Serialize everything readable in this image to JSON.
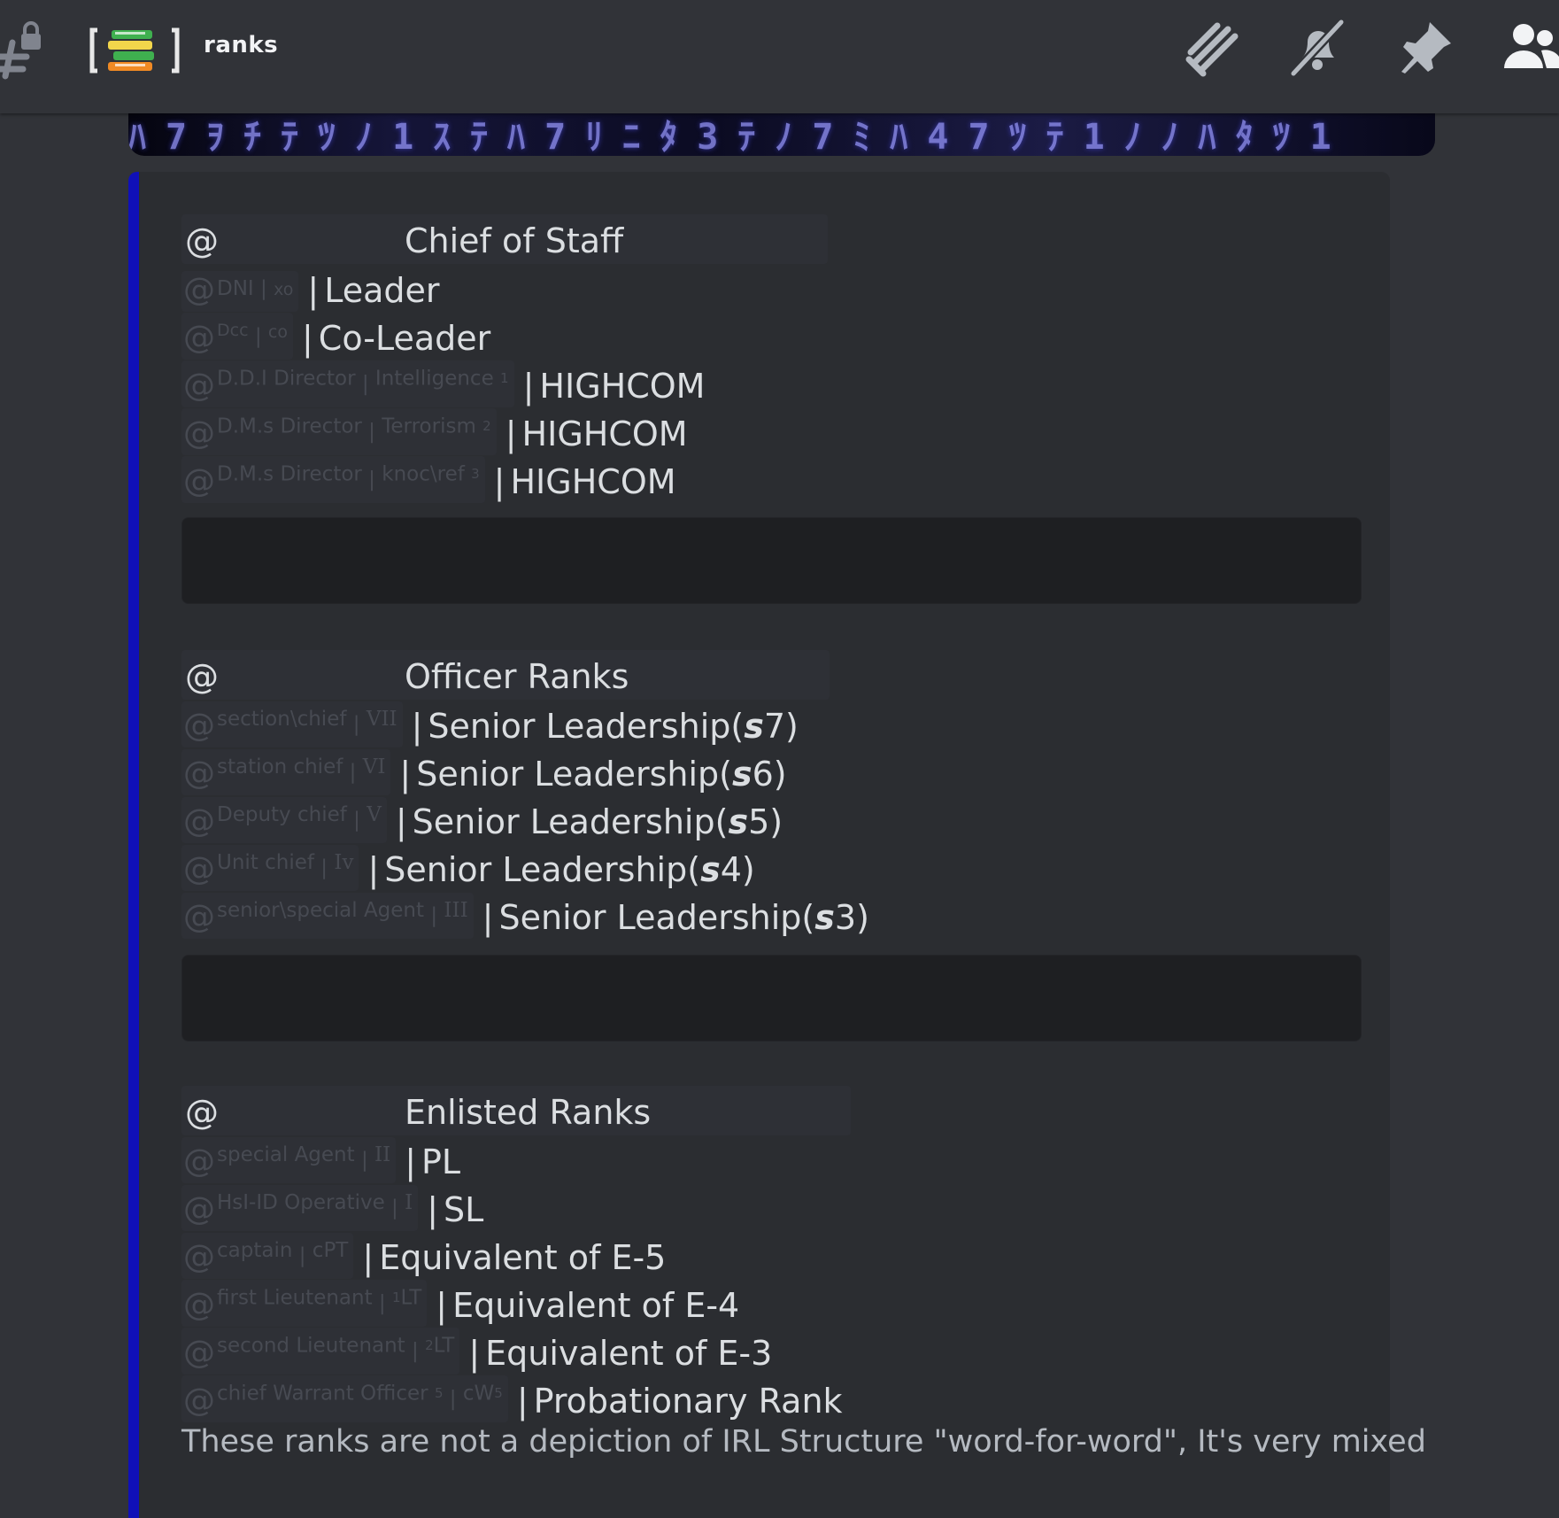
{
  "header": {
    "channel_name": "ranks",
    "icons": [
      "locked-text-channel-icon",
      "books-emoji-icon",
      "threads-icon",
      "bell-muted-icon",
      "pin-icon",
      "members-icon"
    ]
  },
  "banner": {
    "glyphs": "ﾊ7ｦﾁﾃﾂﾉ1ｽﾃﾊ7ﾘﾆﾀ3ﾃﾉ7ﾐﾊ47ﾂﾃ1ﾉﾉﾊﾀﾂ1"
  },
  "sections": [
    {
      "at": "@",
      "title": "Chief of Staff",
      "rows": [
        {
          "mention": "DNI",
          "sub": "xo",
          "text": "Leader"
        },
        {
          "mention": "Dcc",
          "sub": "co",
          "text": "Co-Leader"
        },
        {
          "mention": "D.D.I Director",
          "sub": "Intelligence",
          "sup": "1",
          "text": "HIGHCOM"
        },
        {
          "mention": "D.M.s Director",
          "sub": "Terrorism",
          "sup": "2",
          "text": "HIGHCOM"
        },
        {
          "mention": "D.M.s Director",
          "sub": "knoc\\ref",
          "sup": "3",
          "text": "HIGHCOM"
        }
      ]
    },
    {
      "at": "@",
      "title": "Officer Ranks",
      "rows": [
        {
          "mention": "section\\chief",
          "sub": "VII",
          "text_pre": "Senior Leadership(",
          "text_em": "s",
          "text_post": "7)"
        },
        {
          "mention": "station chief",
          "sub": "VI",
          "text_pre": "Senior Leadership(",
          "text_em": "s",
          "text_post": "6)"
        },
        {
          "mention": "Deputy chief",
          "sub": "V",
          "text_pre": "Senior Leadership(",
          "text_em": "s",
          "text_post": "5)"
        },
        {
          "mention": "Unit chief",
          "sub": "Iv",
          "text_pre": "Senior Leadership(",
          "text_em": "s",
          "text_post": "4)"
        },
        {
          "mention": "senior\\special Agent",
          "sub": "III",
          "text_pre": "Senior Leadership(",
          "text_em": "s",
          "text_post": "3)"
        }
      ]
    },
    {
      "at": "@",
      "title": "Enlisted Ranks",
      "rows": [
        {
          "mention": "special Agent",
          "sub": "II",
          "text": "PL"
        },
        {
          "mention": "HsI-ID Operative",
          "sub": "I",
          "text": "SL"
        },
        {
          "mention": "captain",
          "sub": "cPT",
          "text": "Equivalent of E-5"
        },
        {
          "mention": "first Lieutenant",
          "sub_sup": "1",
          "sub": "LT",
          "text": "Equivalent of E-4"
        },
        {
          "mention": "second Lieutenant",
          "sub_sup": "2",
          "sub": "LT",
          "text": "Equivalent of E-3"
        },
        {
          "mention": "chief Warrant Officer",
          "sup": "5",
          "sub": "cW",
          "sub_tail_sup": "5",
          "text": "Probationary Rank"
        }
      ]
    }
  ],
  "separator": "|",
  "footer_note": "These ranks are not a depiction of IRL Structure \"word-for-word\", It's very mixed",
  "colors": {
    "embed_accent": "#1010b8",
    "background": "#313338",
    "embed_bg": "#2b2d31",
    "codeblock_bg": "#1e1f22"
  }
}
